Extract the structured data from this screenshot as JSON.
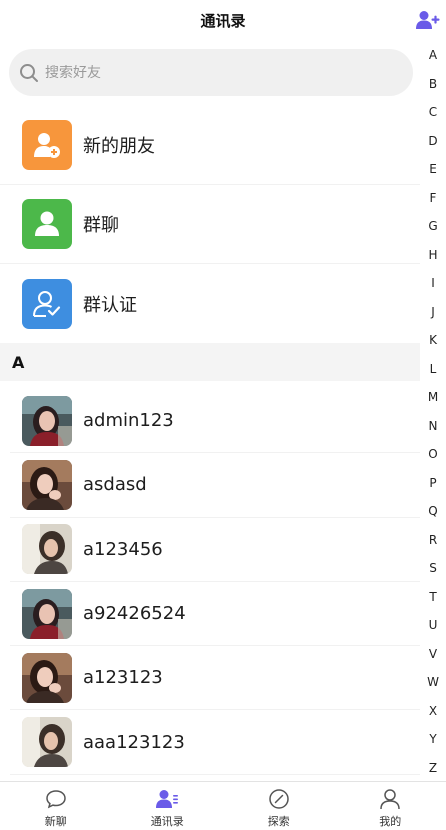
{
  "header": {
    "title": "通讯录"
  },
  "search": {
    "placeholder": "搜索好友"
  },
  "functions": [
    {
      "label": "新的朋友",
      "color": "#f7963c",
      "icon": "person-add-icon"
    },
    {
      "label": "群聊",
      "color": "#4cb84a",
      "icon": "group-chat-icon"
    },
    {
      "label": "群认证",
      "color": "#3e8ee0",
      "icon": "group-verify-icon"
    }
  ],
  "section": {
    "letter": "A"
  },
  "contacts": [
    {
      "name": "admin123"
    },
    {
      "name": "asdasd"
    },
    {
      "name": "a123456"
    },
    {
      "name": "a92426524"
    },
    {
      "name": "a123123"
    },
    {
      "name": "aaa123123"
    }
  ],
  "index_letters": [
    "A",
    "B",
    "C",
    "D",
    "E",
    "F",
    "G",
    "H",
    "I",
    "J",
    "K",
    "L",
    "M",
    "N",
    "O",
    "P",
    "Q",
    "R",
    "S",
    "T",
    "U",
    "V",
    "W",
    "X",
    "Y",
    "Z"
  ],
  "tabs": [
    {
      "label": "新聊",
      "icon": "chat-bubble-icon"
    },
    {
      "label": "通讯录",
      "icon": "contacts-icon",
      "active": true
    },
    {
      "label": "探索",
      "icon": "compass-icon"
    },
    {
      "label": "我的",
      "icon": "profile-icon"
    }
  ],
  "colors": {
    "accent": "#6a5be8",
    "search_bg": "#f0f0f0",
    "section_bg": "#f4f4f4"
  }
}
